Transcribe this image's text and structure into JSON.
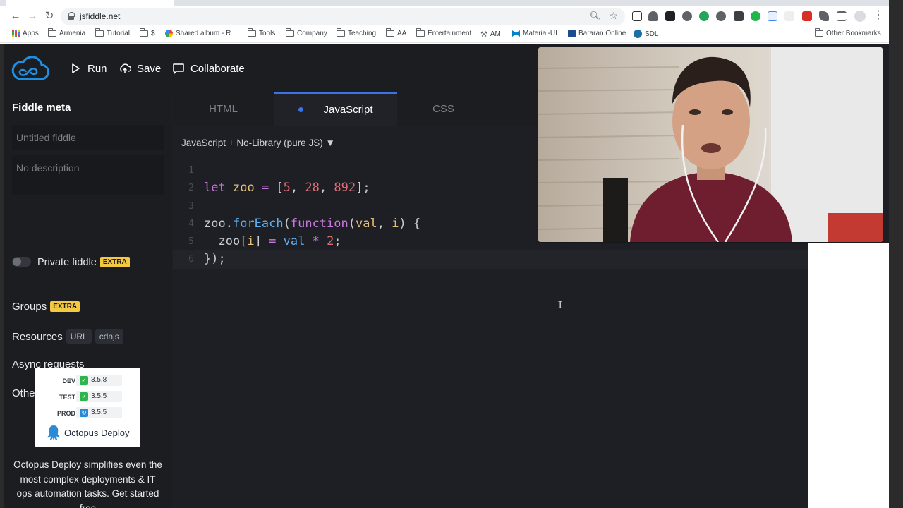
{
  "browser": {
    "url": "jsfiddle.net",
    "bookmarks": [
      "Apps",
      "Armenia",
      "Tutorial",
      "$",
      "Shared album - R...",
      "Tools",
      "Company",
      "Teaching",
      "AA",
      "Entertainment",
      "AM",
      "Material-UI",
      "Bararan Online",
      "SDL"
    ],
    "other_bookmarks": "Other Bookmarks"
  },
  "header": {
    "run_label": "Run",
    "save_label": "Save",
    "collaborate_label": "Collaborate"
  },
  "sidebar": {
    "title": "Fiddle meta",
    "title_placeholder": "Untitled fiddle",
    "description_placeholder": "No description",
    "private_label": "Private fiddle",
    "extra_badge": "EXTRA",
    "groups_label": "Groups",
    "resources_label": "Resources",
    "resources_chips": [
      "URL",
      "cdnjs"
    ],
    "async_label": "Async requests",
    "other_label": "Other (links, license)"
  },
  "ad": {
    "rows": [
      {
        "env": "DEV",
        "version": "3.5.8",
        "color": "#2fb44b"
      },
      {
        "env": "TEST",
        "version": "3.5.5",
        "color": "#2fb44b"
      },
      {
        "env": "PROD",
        "version": "3.5.5",
        "color": "#2a8ad6"
      }
    ],
    "brand": "Octopus Deploy",
    "copy": "Octopus Deploy simplifies even the most complex deployments & IT ops automation tasks. Get started free"
  },
  "editor": {
    "tabs": [
      "HTML",
      "JavaScript",
      "CSS"
    ],
    "active_tab": "JavaScript",
    "language_label": "JavaScript + No-Library (pure JS) ▼",
    "line_numbers": [
      "1",
      "2",
      "3",
      "4",
      "5",
      "6"
    ]
  },
  "colors": {
    "accent": "#3b73e8",
    "extra_badge": "#f5c842",
    "keyword": "#c678dd",
    "variable": "#e5c07b",
    "number": "#e06c75",
    "function": "#61afef"
  }
}
